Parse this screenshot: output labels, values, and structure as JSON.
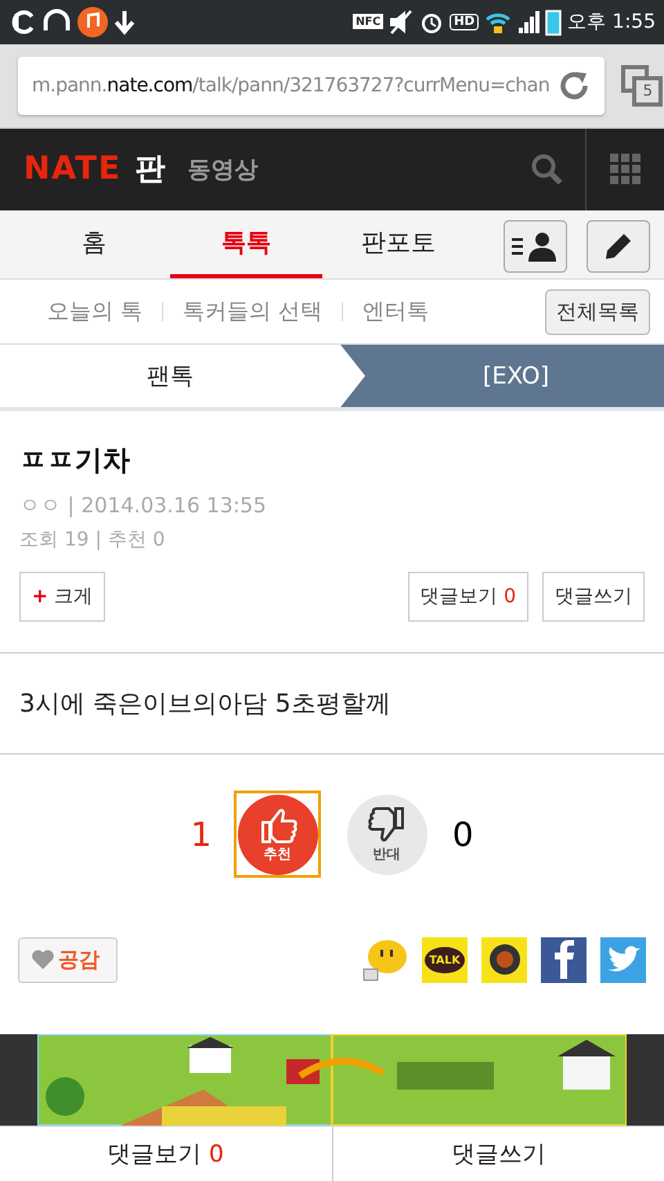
{
  "status_bar": {
    "time": "오후 1:55",
    "nfc": "NFC",
    "hd": "HD"
  },
  "browser": {
    "url_prefix": "m.pann.",
    "url_domain": "nate.com",
    "url_rest": "/talk/pann/321763727?currMenu=chan",
    "tab_count": "5"
  },
  "header": {
    "logo": "NATE",
    "logo_pan": "판",
    "section": "동영상"
  },
  "tabs": [
    {
      "label": "홈",
      "selected": false
    },
    {
      "label": "톡톡",
      "selected": true
    },
    {
      "label": "판포토",
      "selected": false
    }
  ],
  "subtabs": [
    {
      "label": "오늘의 톡"
    },
    {
      "label": "톡커들의 선택"
    },
    {
      "label": "엔터톡"
    }
  ],
  "all_list_button": "전체목록",
  "breadcrumb": {
    "parent": "팬톡",
    "current": "[EXO]"
  },
  "post": {
    "separator": "|",
    "title": "ㅍㅍ기차",
    "author": "ㅇㅇ",
    "date": "2014.03.16 13:55",
    "views_label": "조회",
    "views": "19",
    "recommend_label": "추천",
    "recommend": "0",
    "enlarge_plus": "+",
    "enlarge": "크게",
    "view_comments": "댓글보기",
    "comment_count": "0",
    "write_comment": "댓글쓰기",
    "body": "3시에 죽은이브의아담 5초평할께"
  },
  "vote": {
    "up_count": "1",
    "up_label": "추천",
    "up_selected": true,
    "down_label": "반대",
    "down_count": "0"
  },
  "empathy": "공감",
  "share": {
    "talk": "TALK"
  },
  "bottom": {
    "view_comments": "댓글보기",
    "comment_count": "0",
    "write_comment": "댓글쓰기"
  }
}
